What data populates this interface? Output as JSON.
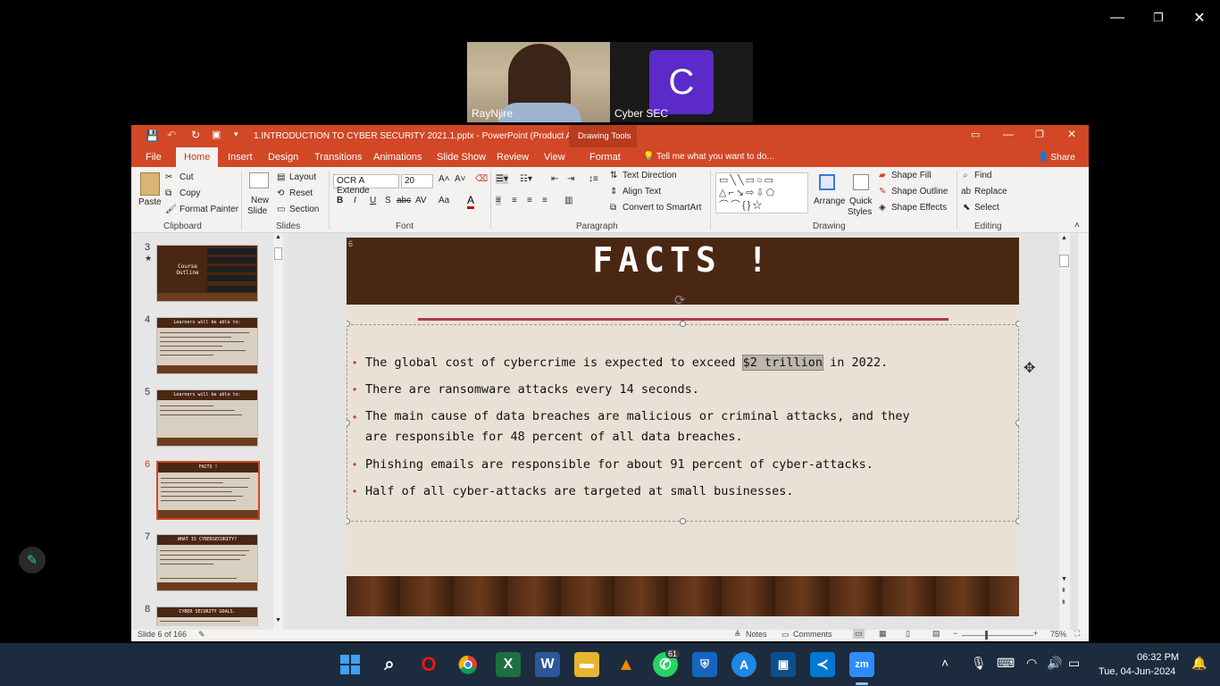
{
  "meeting": {
    "participants": [
      {
        "name": "RayNjire"
      },
      {
        "name": "Cyber SEC",
        "initial": "C"
      }
    ],
    "window_controls": {
      "minimize": "—",
      "restore": "❐",
      "close": "✕"
    }
  },
  "ppt": {
    "title": "1.INTRODUCTION TO CYBER SECURITY 2021.1.pptx - PowerPoint (Product Activati...",
    "context_tab_group": "Drawing Tools",
    "tabs": [
      "File",
      "Home",
      "Insert",
      "Design",
      "Transitions",
      "Animations",
      "Slide Show",
      "Review",
      "View",
      "Format"
    ],
    "active_tab": "Home",
    "tell_me": "Tell me what you want to do...",
    "share": "Share",
    "ribbon": {
      "clipboard": {
        "paste": "Paste",
        "cut": "Cut",
        "copy": "Copy",
        "format_painter": "Format Painter",
        "label": "Clipboard"
      },
      "slides": {
        "new_slide_1": "New",
        "new_slide_2": "Slide",
        "layout": "Layout",
        "reset": "Reset",
        "section": "Section",
        "label": "Slides"
      },
      "font": {
        "name": "OCR A Extende",
        "size": "20",
        "label": "Font"
      },
      "paragraph": {
        "text_direction": "Text Direction",
        "align_text": "Align Text",
        "convert_smartart": "Convert to SmartArt",
        "label": "Paragraph"
      },
      "drawing": {
        "arrange": "Arrange",
        "quick_styles_1": "Quick",
        "quick_styles_2": "Styles",
        "shape_fill": "Shape Fill",
        "shape_outline": "Shape Outline",
        "shape_effects": "Shape Effects",
        "label": "Drawing"
      },
      "editing": {
        "find": "Find",
        "replace": "Replace",
        "select": "Select",
        "label": "Editing"
      }
    },
    "thumbnails": [
      {
        "num": "3",
        "star": "★",
        "title": "Course Outline"
      },
      {
        "num": "4",
        "title": "Learners will be able to:"
      },
      {
        "num": "5",
        "title": "Learners will be able to:"
      },
      {
        "num": "6",
        "title": "FACTS !"
      },
      {
        "num": "7",
        "title": "WHAT IS CYBERSECURITY?"
      },
      {
        "num": "8",
        "title": "CYBER SECURITY GOALS."
      }
    ],
    "slide": {
      "number": "6",
      "title": "FACTS !",
      "bullets": [
        {
          "before": "The global cost of cybercrime is expected to exceed ",
          "highlight": "$2 trillion",
          "after": " in 2022."
        },
        {
          "text": "There are ransomware attacks every 14 seconds."
        },
        {
          "text": "The main cause of data breaches are malicious or criminal attacks, and they\nare responsible for 48 percent of all data breaches."
        },
        {
          "text": "Phishing emails are responsible for about 91 percent of cyber-attacks."
        },
        {
          "text": "Half of all cyber-attacks are targeted at small businesses."
        }
      ]
    },
    "status": {
      "slide_info": "Slide 6 of 166",
      "notes": "Notes",
      "comments": "Comments",
      "zoom": "75%"
    }
  },
  "taskbar": {
    "whatsapp_badge": "61",
    "time": "06:32 PM",
    "date": "Tue, 04-Jun-2024"
  },
  "colors": {
    "ppt_accent": "#d24726",
    "slide_header": "#4a2713",
    "taskbar": "#1d2b3e"
  }
}
